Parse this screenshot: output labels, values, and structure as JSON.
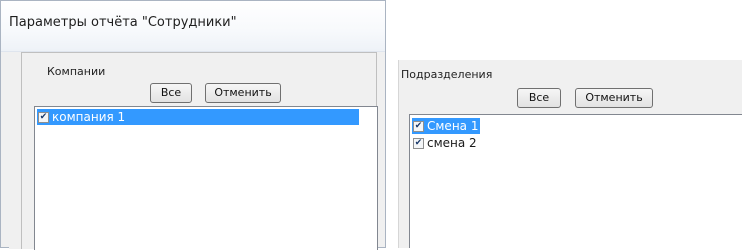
{
  "dialog": {
    "title": "Параметры отчёта \"Сотрудники\""
  },
  "companies": {
    "label": "Компании",
    "all_label": "Все",
    "cancel_label": "Отменить",
    "items": [
      {
        "label": "компания 1",
        "checked": true,
        "selected": true
      }
    ]
  },
  "divisions": {
    "label": "Подразделения",
    "all_label": "Все",
    "cancel_label": "Отменить",
    "items": [
      {
        "label": "Смена 1",
        "checked": true,
        "selected": true
      },
      {
        "label": "смена 2",
        "checked": true,
        "selected": false
      }
    ]
  },
  "colors": {
    "selection": "#3399ff",
    "window_bg": "#f0f0f0",
    "list_bg": "#ffffff"
  },
  "icons": {
    "checkbox_checked": "check-icon"
  }
}
